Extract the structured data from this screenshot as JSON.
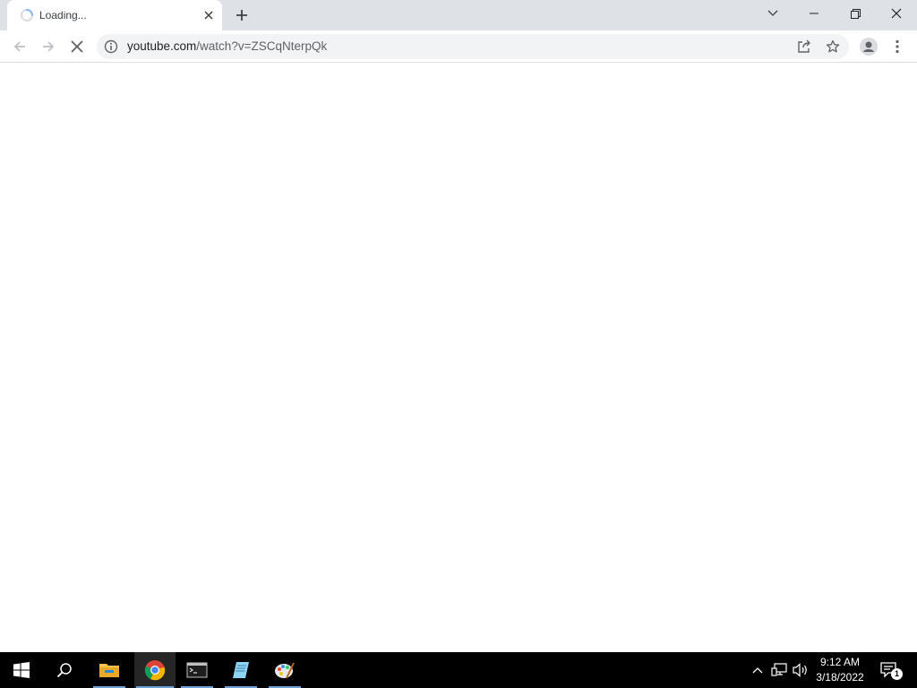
{
  "browser": {
    "tab": {
      "title": "Loading...",
      "icon": "loading-spinner"
    },
    "new_tab_icon": "plus-icon",
    "window_controls": [
      "tab-search-icon",
      "minimize-icon",
      "restore-icon",
      "close-icon"
    ],
    "toolbar": {
      "back_icon": "back-arrow-icon",
      "forward_icon": "forward-arrow-icon",
      "stop_icon": "stop-icon",
      "address": {
        "host": "youtube.com",
        "path": "/watch?v=ZSCqNterpQk"
      },
      "share_icon": "share-icon",
      "bookmark_icon": "star-icon",
      "profile_icon": "profile-icon",
      "menu_icon": "kebab-menu-icon"
    }
  },
  "taskbar": {
    "apps": [
      "start-icon",
      "search-icon",
      "file-explorer-icon",
      "chrome-icon",
      "terminal-icon",
      "notepad-icon",
      "paint-icon"
    ],
    "active_app": "chrome",
    "tray": [
      "chevron-up-icon",
      "network-icon",
      "volume-icon"
    ],
    "clock": {
      "time": "9:12 AM",
      "date": "3/18/2022"
    },
    "notifications": {
      "count": "1"
    }
  }
}
